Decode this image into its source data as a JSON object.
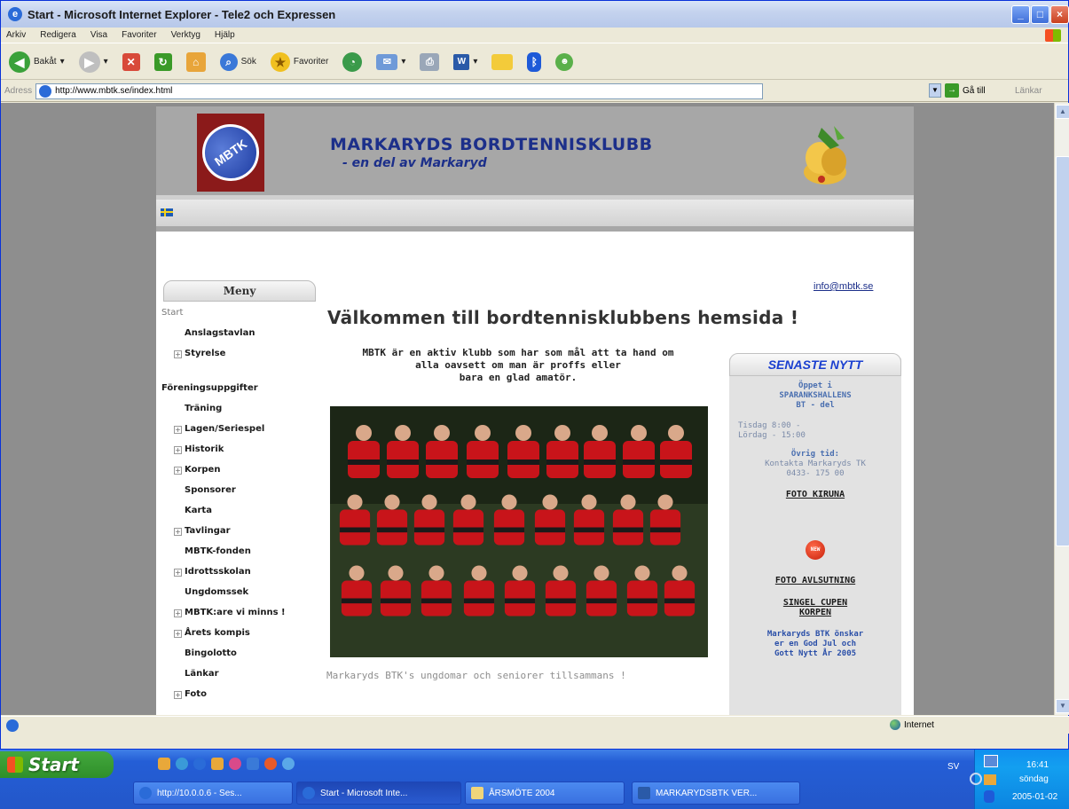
{
  "window": {
    "title": "Start - Microsoft Internet Explorer - Tele2 och Expressen",
    "min_icon": "minimize-icon",
    "max_icon": "maximize-icon",
    "close_icon": "close-icon"
  },
  "menubar": [
    "Arkiv",
    "Redigera",
    "Visa",
    "Favoriter",
    "Verktyg",
    "Hjälp"
  ],
  "toolbar": {
    "back": "Bakåt",
    "search": "Sök",
    "favorites": "Favoriter"
  },
  "address": {
    "label": "Adress",
    "url": "http://www.mbtk.se/index.html",
    "go": "Gå till",
    "links": "Länkar"
  },
  "site": {
    "logo_text": "MBTK",
    "club_name": "MARKARYDS BORDTENNISKLUBB",
    "club_subtitle": "- en del av Markaryd",
    "menu_title": "Meny",
    "menu": [
      {
        "label": "Start",
        "style": "plain",
        "plus": false
      },
      {
        "label": "Anslagstavlan",
        "style": "bold",
        "plus": false
      },
      {
        "label": "Styrelse",
        "style": "bold",
        "plus": true
      },
      {
        "label": "",
        "style": "spacer",
        "plus": false
      },
      {
        "label": "Föreningsuppgifter",
        "style": "head",
        "plus": false
      },
      {
        "label": "Träning",
        "style": "bold",
        "plus": false
      },
      {
        "label": "Lagen/Seriespel",
        "style": "bold",
        "plus": true
      },
      {
        "label": "Historik",
        "style": "bold",
        "plus": true
      },
      {
        "label": "Korpen",
        "style": "bold",
        "plus": true
      },
      {
        "label": "Sponsorer",
        "style": "bold",
        "plus": false
      },
      {
        "label": "Karta",
        "style": "bold",
        "plus": false
      },
      {
        "label": "Tavlingar",
        "style": "bold",
        "plus": true
      },
      {
        "label": "MBTK-fonden",
        "style": "bold",
        "plus": false
      },
      {
        "label": "Idrottsskolan",
        "style": "bold",
        "plus": true
      },
      {
        "label": "Ungdomssek",
        "style": "bold",
        "plus": false
      },
      {
        "label": "MBTK:are vi minns !",
        "style": "bold",
        "plus": true
      },
      {
        "label": "Årets kompis",
        "style": "bold",
        "plus": true
      },
      {
        "label": "Bingolotto",
        "style": "bold",
        "plus": false
      },
      {
        "label": "Länkar",
        "style": "bold",
        "plus": false
      },
      {
        "label": "Foto",
        "style": "bold",
        "plus": true
      }
    ],
    "email": "info@mbtk.se",
    "welcome": "Välkommen till bordtennisklubbens hemsida !",
    "intro": [
      "MBTK är en aktiv klubb som har som mål att ta hand om",
      "alla oavsett om man är proffs eller",
      "bara en glad amatör."
    ],
    "caption": "Markaryds BTK's ungdomar och seniorer tillsammans !",
    "news": {
      "title": "SENASTE NYTT",
      "open_title": "Öppet i",
      "open_place": "SPARANKSHALLENS",
      "open_place2": "BT - del",
      "hours1": "Tisdag  8:00 -",
      "hours2": "Lördag       -  15:00",
      "other_title": "Övrig tid:",
      "contact1": "Kontakta Markaryds TK",
      "contact2": "0433- 175 00",
      "link1": "FOTO KIRUNA",
      "new_badge": "NEW",
      "link2": "FOTO AVLSUTNING",
      "link3a": "SINGEL CUPEN",
      "link3b": "KORPEN",
      "wish1": "Markaryds BTK önskar",
      "wish2": "er en God Jul och",
      "wish3": "Gott Nytt År 2005"
    }
  },
  "status": {
    "zone": "Internet"
  },
  "taskbar": {
    "start": "Start",
    "tasks": [
      "http://10.0.0.6 - Ses...",
      "Start - Microsoft Inte...",
      "ÅRSMÖTE 2004",
      "MARKARYDSBTK VER..."
    ],
    "lang": "SV",
    "time": "16:41",
    "day": "söndag",
    "date": "2005-01-02"
  },
  "colors": {
    "club_blue": "#1c2f8a",
    "news_blue": "#1a3fd0",
    "xp_taskbar": "#245ed6"
  }
}
